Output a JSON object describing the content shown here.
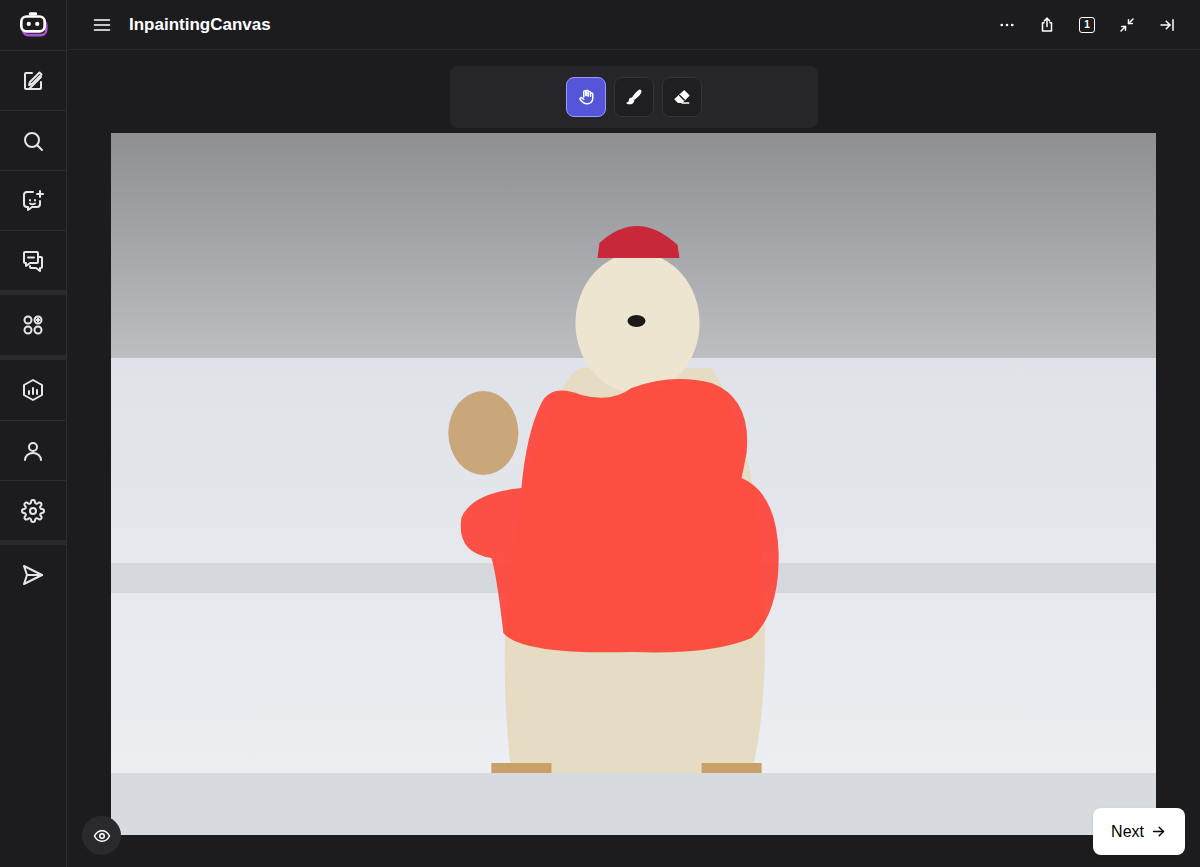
{
  "window": {
    "title": "InpaintingCanvas"
  },
  "sidebar": {
    "groups": [
      {
        "items": [
          {
            "kind": "new-chat"
          },
          {
            "kind": "search"
          },
          {
            "kind": "new-bot"
          },
          {
            "kind": "chats"
          }
        ]
      },
      {
        "items": [
          {
            "kind": "apps"
          }
        ]
      },
      {
        "items": [
          {
            "kind": "analytics"
          },
          {
            "kind": "profile"
          },
          {
            "kind": "settings"
          }
        ]
      },
      {
        "items": [
          {
            "kind": "send"
          }
        ]
      }
    ]
  },
  "header": {
    "actions": [
      {
        "kind": "more"
      },
      {
        "kind": "share"
      },
      {
        "kind": "page-count",
        "text": "1"
      },
      {
        "kind": "minimize"
      },
      {
        "kind": "collapse"
      }
    ]
  },
  "tools": [
    {
      "kind": "hand",
      "selected": true
    },
    {
      "kind": "brush",
      "selected": false
    },
    {
      "kind": "eraser",
      "selected": false
    }
  ],
  "canvas": {
    "mask_visible": true
  },
  "next_button": {
    "label": "Next"
  }
}
